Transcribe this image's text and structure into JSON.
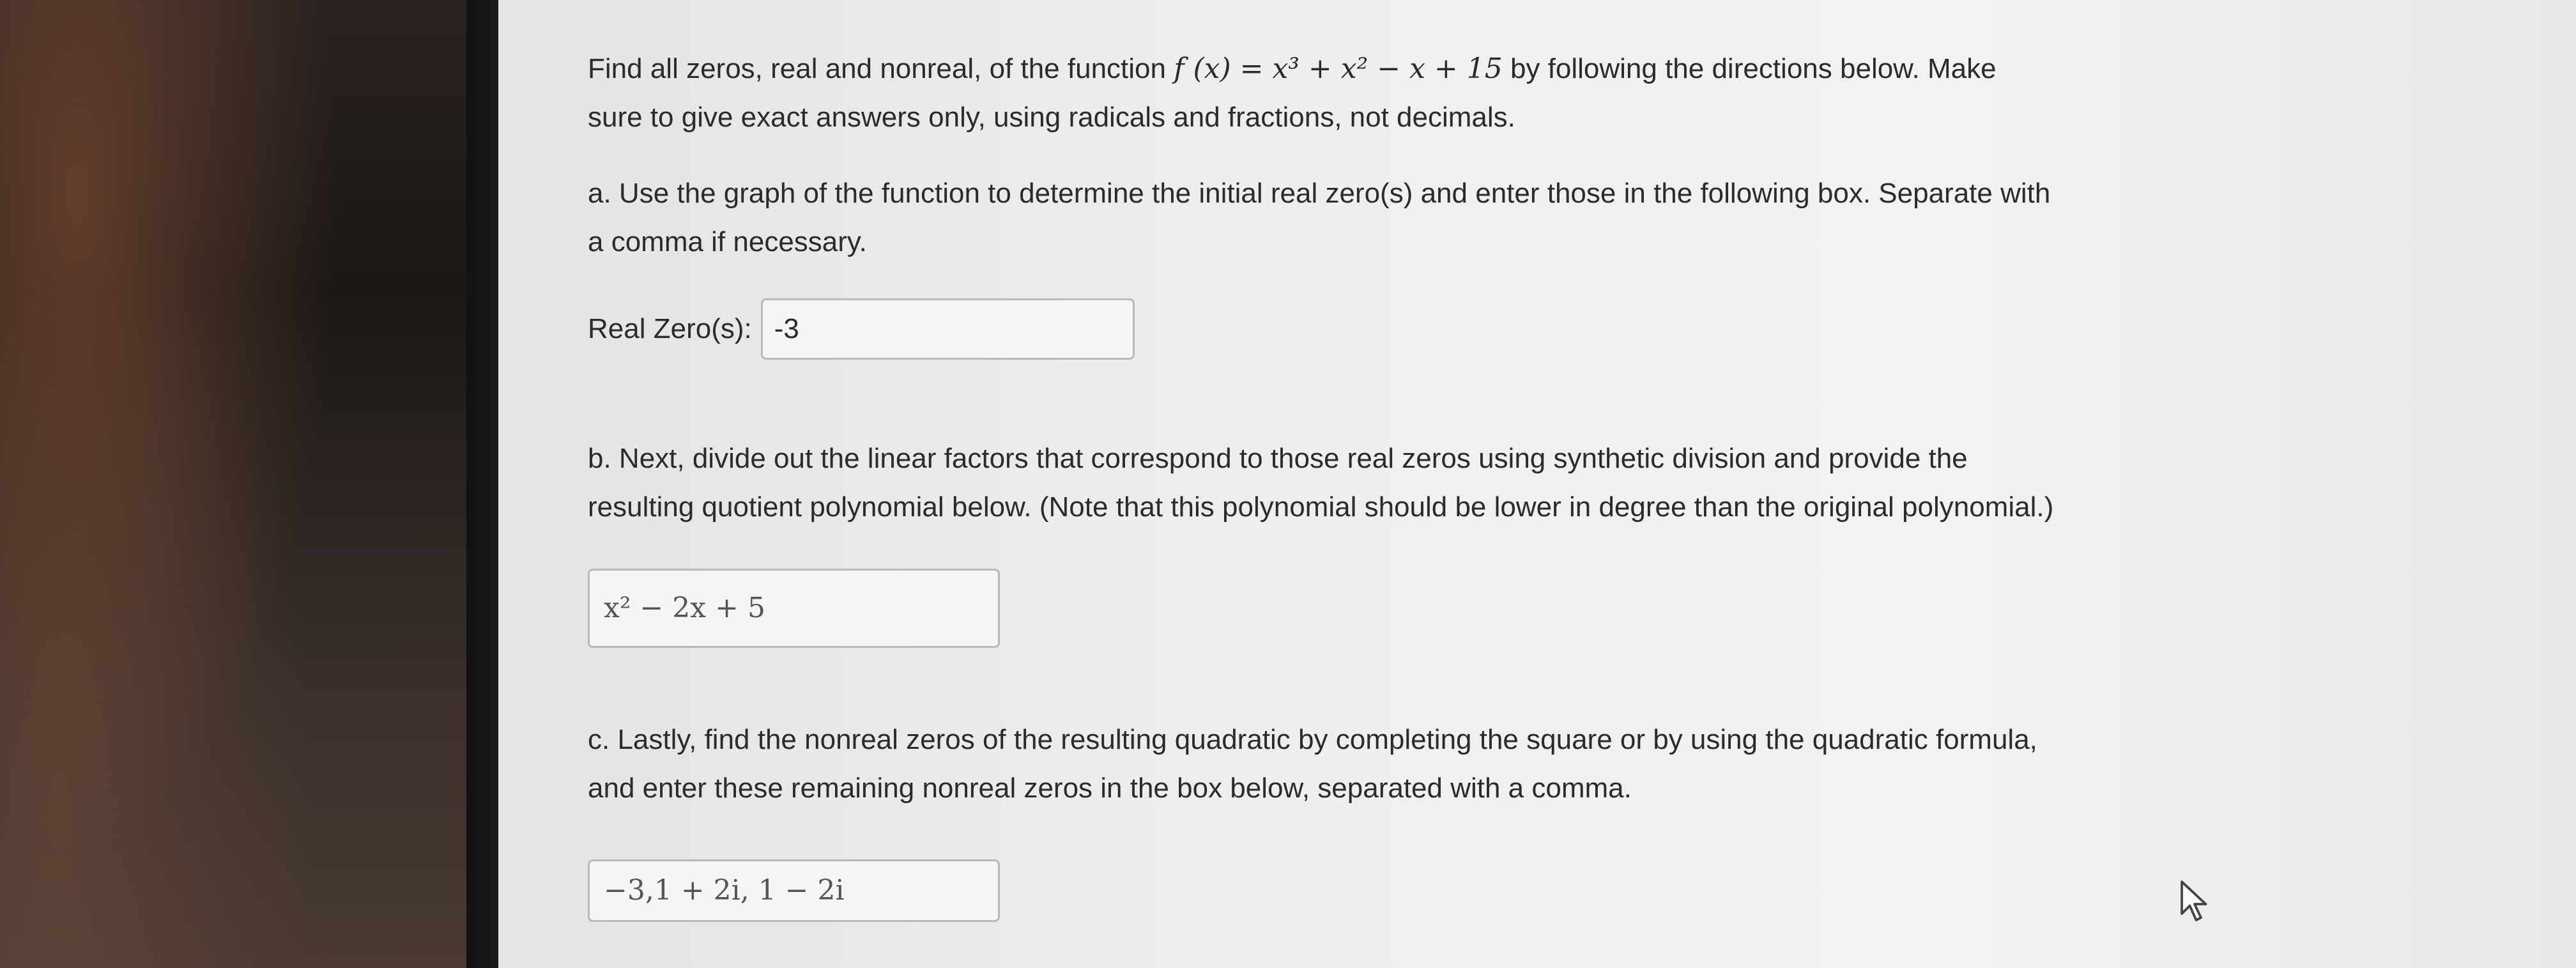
{
  "question": {
    "intro_before": "Find all zeros, real and nonreal, of the function ",
    "function_math": "f (x) = x³ + x² − x + 15",
    "intro_after": " by following the directions below. Make sure to give exact answers only, using radicals and fractions, not decimals."
  },
  "part_a": {
    "text": "a. Use the graph of the function to determine the initial real zero(s) and enter those in the following box. Separate with a comma if necessary.",
    "label": "Real Zero(s):",
    "value": "-3"
  },
  "part_b": {
    "text": "b. Next, divide out the linear factors that correspond to those real zeros using synthetic division and provide the resulting quotient polynomial below. (Note that this polynomial should be lower in degree than the original polynomial.)",
    "value": "x² − 2x + 5"
  },
  "part_c": {
    "text": "c. Lastly, find the nonreal zeros of the resulting quadratic by completing the square or by using the quadratic formula, and enter these remaining nonreal zeros in the box below, separated with a comma.",
    "value": "−3,1 + 2i, 1 − 2i"
  },
  "icons": {
    "cursor": "mouse-pointer-icon"
  }
}
